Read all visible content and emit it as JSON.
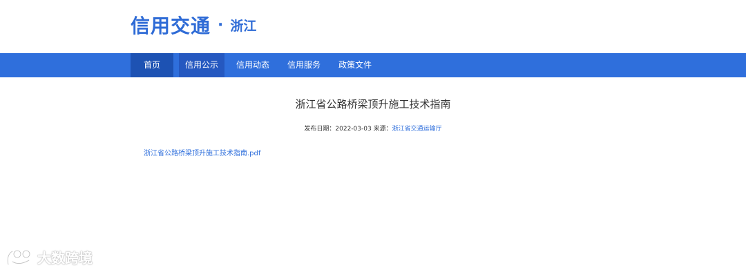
{
  "header": {
    "logo_main": "信用交通",
    "logo_dot": "·",
    "logo_region": "浙江"
  },
  "nav": {
    "items": [
      {
        "label": "首页"
      },
      {
        "label": "信用公示"
      },
      {
        "label": "信用动态"
      },
      {
        "label": "信用服务"
      },
      {
        "label": "政策文件"
      }
    ],
    "active_index": 1
  },
  "article": {
    "title": "浙江省公路桥梁顶升施工技术指南",
    "publish_label": "发布日期：",
    "publish_date": "2022-03-03",
    "source_label": "来源：",
    "source": "浙江省交通运输厅",
    "attachment": "浙江省公路桥梁顶升施工技术指南.pdf"
  },
  "watermark": {
    "text": "大数跨境"
  },
  "colors": {
    "brand": "#2e6bd6",
    "navbar": "#2f6fdc",
    "nav_home": "#1d52b3",
    "link": "#2f6fdc"
  }
}
